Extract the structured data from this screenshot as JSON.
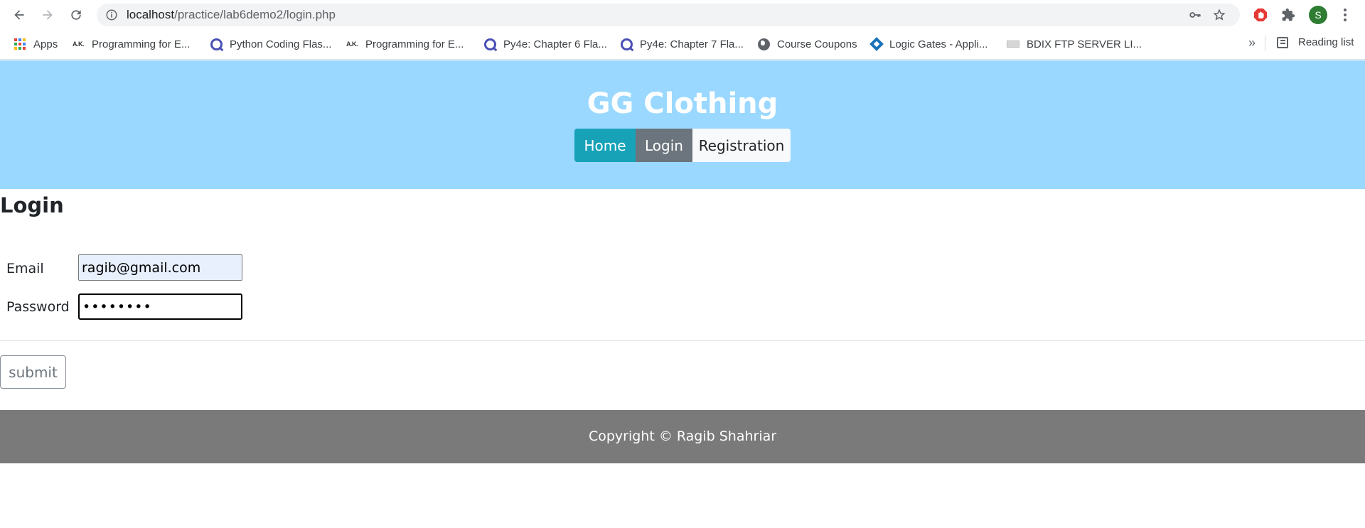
{
  "browser": {
    "url_host": "localhost",
    "url_path": "/practice/lab6demo2/login.php",
    "avatar_initial": "S",
    "icons": [
      "back-icon",
      "forward-icon",
      "reload-icon",
      "site-info-icon",
      "key-icon",
      "star-icon",
      "adblock-extension-icon",
      "puzzle-extensions-icon",
      "menu-icon"
    ],
    "bookmarks": [
      {
        "label": "Apps",
        "icon": "apps-grid-icon"
      },
      {
        "label": "Programming for E...",
        "icon": "ak-favicon-icon"
      },
      {
        "label": "Python Coding Flas...",
        "icon": "quizlet-icon"
      },
      {
        "label": "Programming for E...",
        "icon": "ak-favicon-icon"
      },
      {
        "label": "Py4e: Chapter 6 Fla...",
        "icon": "quizlet-icon"
      },
      {
        "label": "Py4e: Chapter 7 Fla...",
        "icon": "quizlet-icon"
      },
      {
        "label": "Course Coupons",
        "icon": "globe-icon"
      },
      {
        "label": "Logic Gates - Appli...",
        "icon": "diamond-favicon-icon"
      },
      {
        "label": "BDIX FTP SERVER LI...",
        "icon": "bdix-favicon-icon"
      }
    ],
    "overflow_label": "»",
    "reading_list_label": "Reading list"
  },
  "site": {
    "title": "GG Clothing",
    "nav": {
      "home": "Home",
      "login": "Login",
      "registration": "Registration"
    },
    "colors": {
      "header_bg": "#9ad8ff",
      "home_btn": "#17a2b8",
      "login_btn": "#6c757d",
      "registration_btn": "#f8f9fa",
      "footer_bg": "#7a7a7a"
    }
  },
  "form": {
    "heading": "Login",
    "email_label": "Email",
    "email_value": "ragib@gmail.com",
    "password_label": "Password",
    "password_value": "••••••••",
    "submit_label": "submit"
  },
  "footer": {
    "text": "Copyright © Ragib Shahriar"
  }
}
